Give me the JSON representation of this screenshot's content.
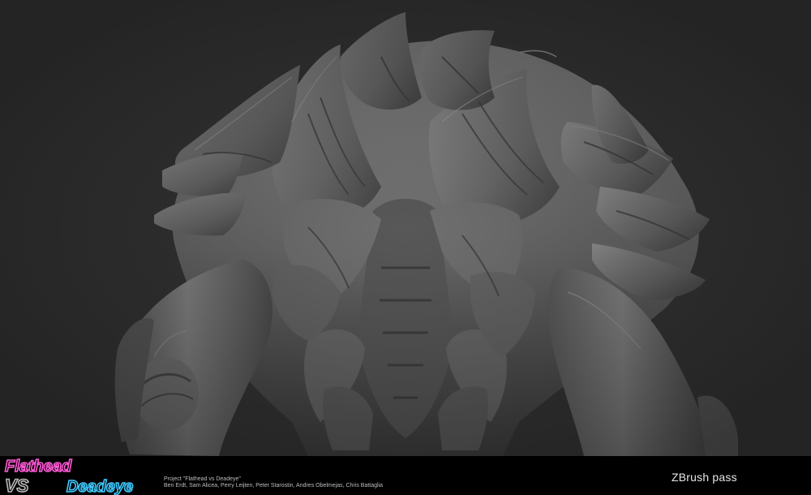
{
  "logo": {
    "line1": "Flathead",
    "line2_vs": "VS",
    "line2_name": "Deadeye",
    "color_flathead": "#ff5ad6",
    "color_deadeye": "#3ec9ff",
    "color_vs": "#b9b9b9"
  },
  "credits": {
    "project_line": "Project \"Flathead vs Deadeye\"",
    "names_line": "Ben Erdt, Sam Alicea, Perry Leijten, Peter Starostin, Andres Obelmejas, Chris Battaglia"
  },
  "caption": {
    "pass_label": "ZBrush pass"
  },
  "render": {
    "subject": "grey sculpted creature back with spikes",
    "background_color": "#2f2f2f",
    "clay_color": "#6f6f6f"
  }
}
